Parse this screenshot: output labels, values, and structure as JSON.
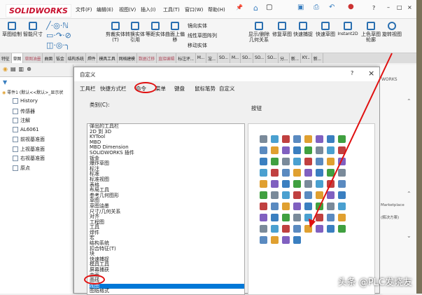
{
  "app": {
    "logo": "SOLIDWORKS",
    "menu": [
      "文件(F)",
      "编辑(E)",
      "视图(V)",
      "插入(I)",
      "工具(T)",
      "窗口(W)",
      "帮助(H)"
    ],
    "window_controls": [
      "?",
      "–",
      "□",
      "×"
    ]
  },
  "ribbon": {
    "buttons": [
      "草图绘制",
      "智能尺寸",
      "剪裁实体(T)",
      "转换实体引用",
      "等距实体",
      "曲面上偏移",
      "显示/删除几何关系",
      "修复草图",
      "快速捕捉",
      "快速草图",
      "Instant2D",
      "上色草图轮廓",
      "旋转视图"
    ],
    "small": [
      "镜向实体",
      "线性草图阵列",
      "移动实体"
    ]
  },
  "tabs": [
    "特征",
    "草图",
    "草图油墨",
    "曲面",
    "钣金",
    "结构系统",
    "焊件",
    "模具工具",
    "网格建模",
    "数据迁移",
    "直接编辑",
    "标注评...",
    "M...",
    "渲...",
    "SO...",
    "M...",
    "SO...",
    "SO...",
    "SO...",
    "分...",
    "新...",
    "KY...",
    "新..."
  ],
  "tree": {
    "root": "零件1 (默认<<默认>_显示状",
    "items": [
      "History",
      "传感器",
      "注解",
      "AL6061",
      "前视基准面",
      "上视基准面",
      "右视基准面",
      "原点"
    ]
  },
  "dialog": {
    "title": "自定义",
    "help": "?",
    "close": "×",
    "tabs": [
      "工具栏",
      "快捷方式栏",
      "命令",
      "菜单",
      "键盘",
      "鼠标笔势",
      "自定义"
    ],
    "category_label": "类别(C):",
    "buttons_label": "按钮",
    "categories": [
      "弹出的工具栏",
      "2D 到 3D",
      "KYTool",
      "MBD",
      "MBD Dimension",
      "SOLIDWORKS 插件",
      "钣金",
      "爆炸草图",
      "标注",
      "标准",
      "标准视图",
      "表格",
      "布局工具",
      "参考几何图形",
      "草图",
      "草图油墨",
      "尺寸/几何关系",
      "对齐",
      "工程图",
      "工具",
      "焊件",
      "宏",
      "结构系统",
      "扣合特征(T)",
      "块",
      "快速捕捉",
      "模具工具",
      "屏幕捕获",
      "曲面",
      "曲线",
      "视图",
      "图纸格式"
    ],
    "selected_category": "视图"
  },
  "taskpane": {
    "title": "WORKS",
    "items": [
      "Marketplace",
      "(解决方案)"
    ]
  },
  "watermark": "头条 @PLC发烧友",
  "icon_colors": [
    "#7a8a9a",
    "#5a8ac0",
    "#3a7fc0",
    "#4aa0d0",
    "#e0a030",
    "#40a040",
    "#c04040",
    "#8060c0"
  ],
  "icon_count": 76
}
